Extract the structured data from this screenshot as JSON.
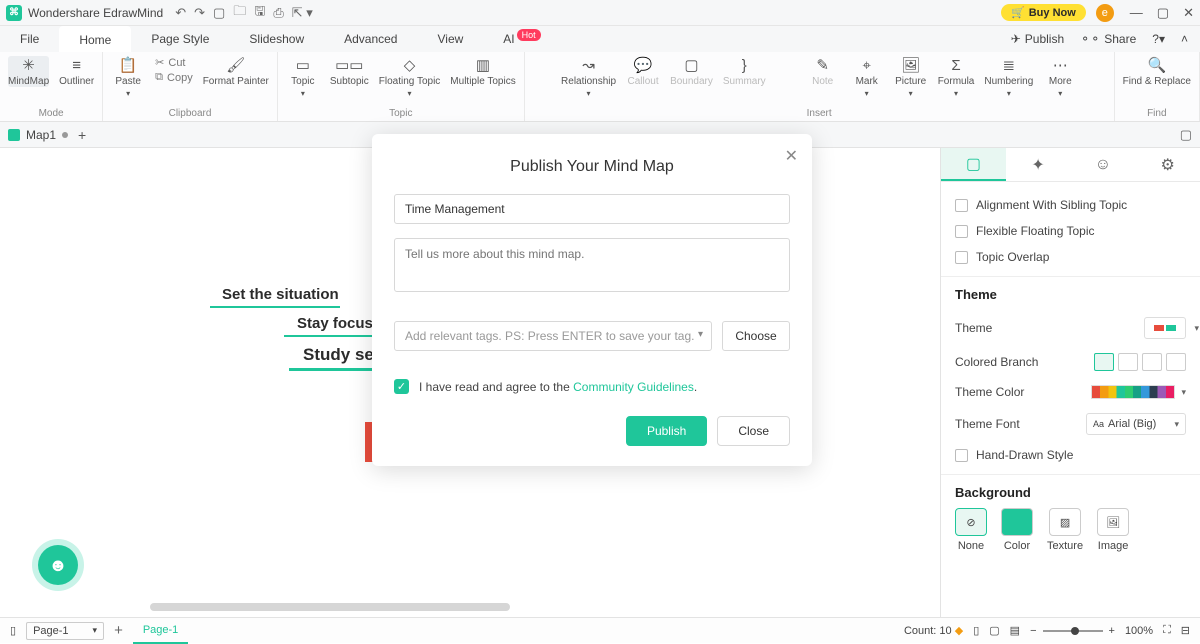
{
  "titlebar": {
    "appname": "Wondershare EdrawMind",
    "buynow": "Buy Now",
    "avatar": "e"
  },
  "menu": {
    "file": "File",
    "home": "Home",
    "pagestyle": "Page Style",
    "slideshow": "Slideshow",
    "advanced": "Advanced",
    "view": "View",
    "ai": "AI",
    "hot": "Hot",
    "publish": "Publish",
    "share": "Share"
  },
  "ribbon": {
    "mindmap": "MindMap",
    "outliner": "Outliner",
    "modeLabel": "Mode",
    "paste": "Paste",
    "cut": "Cut",
    "copy": "Copy",
    "formatpainter": "Format Painter",
    "clipboardLabel": "Clipboard",
    "topic": "Topic",
    "subtopic": "Subtopic",
    "floating": "Floating Topic",
    "multiple": "Multiple Topics",
    "topicLabel": "Topic",
    "relationship": "Relationship",
    "callout": "Callout",
    "boundary": "Boundary",
    "summary": "Summary",
    "note": "Note",
    "mark": "Mark",
    "picture": "Picture",
    "formula": "Formula",
    "numbering": "Numbering",
    "more": "More",
    "insertLabel": "Insert",
    "findreplace": "Find & Replace",
    "findLabel": "Find"
  },
  "doc": {
    "tab": "Map1"
  },
  "canvas": {
    "n1": "Set the situation",
    "n2": "Stay focused",
    "n3": "Study se"
  },
  "rightpanel": {
    "alignSibling": "Alignment With Sibling Topic",
    "flexFloat": "Flexible Floating Topic",
    "topicOverlap": "Topic Overlap",
    "themeTitle": "Theme",
    "themeLabel": "Theme",
    "coloredBranch": "Colored Branch",
    "themeColor": "Theme Color",
    "themeFont": "Theme Font",
    "fontValue": "Arial (Big)",
    "handDrawn": "Hand-Drawn Style",
    "bgTitle": "Background",
    "bgNone": "None",
    "bgColor": "Color",
    "bgTexture": "Texture",
    "bgImage": "Image"
  },
  "dialog": {
    "title": "Publish Your Mind Map",
    "nameValue": "Time Management",
    "descPlaceholder": "Tell us more about this mind map.",
    "tagPlaceholder": "Add relevant tags. PS: Press ENTER to save your tag.",
    "choose": "Choose",
    "agreePrefix": "I have read and agree to the ",
    "agreeLink": "Community Guidelines",
    "publish": "Publish",
    "close": "Close"
  },
  "status": {
    "page": "Page-1",
    "pageTab": "Page-1",
    "count": "Count: 10",
    "zoom": "100%"
  }
}
